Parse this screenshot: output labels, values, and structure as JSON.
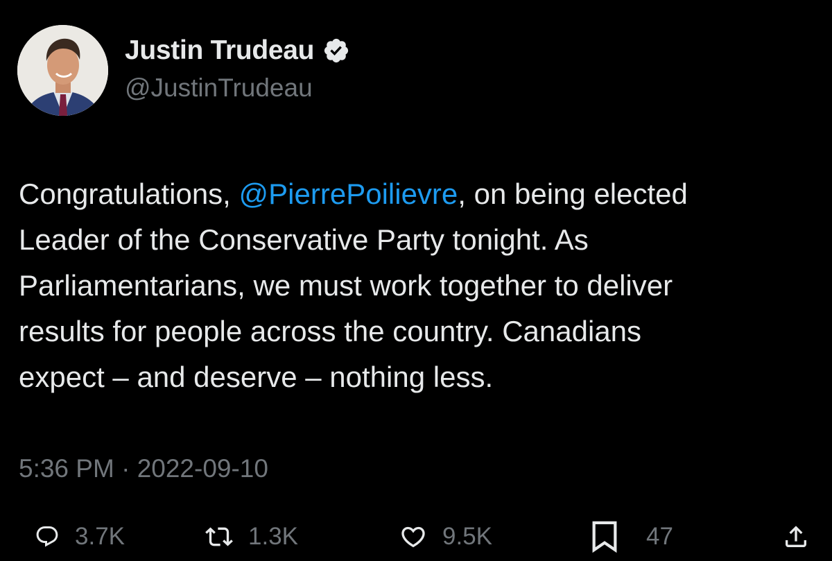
{
  "author": {
    "display_name": "Justin Trudeau",
    "handle": "@JustinTrudeau",
    "verified": true
  },
  "tweet": {
    "lines": [
      [
        "Congratulations, ",
        "@PierrePoilievre",
        ", on being elected"
      ],
      [
        "Leader of the Conservative Party tonight. As"
      ],
      [
        "Parliamentarians, we must work together to deliver"
      ],
      [
        "results for people across the country. Canadians"
      ],
      [
        "expect – and deserve – nothing less."
      ]
    ],
    "line1_pre": "Congratulations, ",
    "mention": "@PierrePoilievre",
    "line1_post": ", on being elected",
    "line2": "Leader of the Conservative Party tonight. As",
    "line3": "Parliamentarians, we must work together to deliver",
    "line4": "results for people across the country. Canadians",
    "line5": "expect – and deserve – nothing less."
  },
  "meta": {
    "time": "5:36 PM",
    "separator": " · ",
    "date": "2022-09-10"
  },
  "actions": {
    "replies": "3.7K",
    "retweets": "1.3K",
    "likes": "9.5K",
    "bookmarks": "47"
  },
  "icons": {
    "reply": "reply-icon",
    "retweet": "retweet-icon",
    "like": "heart-icon",
    "bookmark": "bookmark-icon",
    "share": "share-icon",
    "verified": "verified-badge-icon"
  },
  "colors": {
    "background": "#000000",
    "text": "#e7e9ea",
    "secondary": "#71767b",
    "link": "#1d9bf0",
    "verified_badge": "#e7e9ea"
  }
}
